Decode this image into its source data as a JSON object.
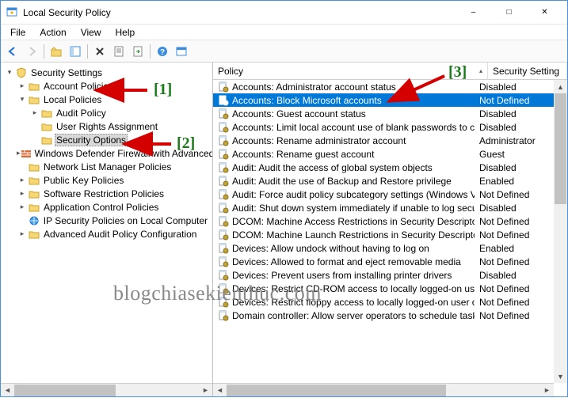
{
  "window": {
    "title": "Local Security Policy"
  },
  "menu": {
    "file": "File",
    "action": "Action",
    "view": "View",
    "help": "Help"
  },
  "tree": {
    "root": "Security Settings",
    "nodes": [
      {
        "label": "Account Policies",
        "level": 1,
        "exp": "closed",
        "icon": "folder"
      },
      {
        "label": "Local Policies",
        "level": 1,
        "exp": "open",
        "icon": "folder"
      },
      {
        "label": "Audit Policy",
        "level": 2,
        "exp": "closed",
        "icon": "folder"
      },
      {
        "label": "User Rights Assignment",
        "level": 2,
        "exp": "leaf",
        "icon": "folder"
      },
      {
        "label": "Security Options",
        "level": 2,
        "exp": "leaf",
        "icon": "folder",
        "selected": true
      },
      {
        "label": "Windows Defender Firewall with Advanced Security",
        "level": 1,
        "exp": "closed",
        "icon": "firewall"
      },
      {
        "label": "Network List Manager Policies",
        "level": 1,
        "exp": "leaf",
        "icon": "folder"
      },
      {
        "label": "Public Key Policies",
        "level": 1,
        "exp": "closed",
        "icon": "folder"
      },
      {
        "label": "Software Restriction Policies",
        "level": 1,
        "exp": "closed",
        "icon": "folder"
      },
      {
        "label": "Application Control Policies",
        "level": 1,
        "exp": "closed",
        "icon": "folder"
      },
      {
        "label": "IP Security Policies on Local Computer",
        "level": 1,
        "exp": "leaf",
        "icon": "ipsec"
      },
      {
        "label": "Advanced Audit Policy Configuration",
        "level": 1,
        "exp": "closed",
        "icon": "folder"
      }
    ]
  },
  "list": {
    "header_policy": "Policy",
    "header_setting": "Security Setting",
    "rows": [
      {
        "policy": "Accounts: Administrator account status",
        "setting": "Disabled",
        "selected": false
      },
      {
        "policy": "Accounts: Block Microsoft accounts",
        "setting": "Not Defined",
        "selected": true
      },
      {
        "policy": "Accounts: Guest account status",
        "setting": "Disabled",
        "selected": false
      },
      {
        "policy": "Accounts: Limit local account use of blank passwords to co...",
        "setting": "Disabled",
        "selected": false
      },
      {
        "policy": "Accounts: Rename administrator account",
        "setting": "Administrator",
        "selected": false
      },
      {
        "policy": "Accounts: Rename guest account",
        "setting": "Guest",
        "selected": false
      },
      {
        "policy": "Audit: Audit the access of global system objects",
        "setting": "Disabled",
        "selected": false
      },
      {
        "policy": "Audit: Audit the use of Backup and Restore privilege",
        "setting": "Enabled",
        "selected": false
      },
      {
        "policy": "Audit: Force audit policy subcategory settings (Windows Vis...",
        "setting": "Not Defined",
        "selected": false
      },
      {
        "policy": "Audit: Shut down system immediately if unable to log secur...",
        "setting": "Disabled",
        "selected": false
      },
      {
        "policy": "DCOM: Machine Access Restrictions in Security Descriptor D...",
        "setting": "Not Defined",
        "selected": false
      },
      {
        "policy": "DCOM: Machine Launch Restrictions in Security Descriptor ...",
        "setting": "Not Defined",
        "selected": false
      },
      {
        "policy": "Devices: Allow undock without having to log on",
        "setting": "Enabled",
        "selected": false
      },
      {
        "policy": "Devices: Allowed to format and eject removable media",
        "setting": "Not Defined",
        "selected": false
      },
      {
        "policy": "Devices: Prevent users from installing printer drivers",
        "setting": "Disabled",
        "selected": false
      },
      {
        "policy": "Devices: Restrict CD-ROM access to locally logged-on user ...",
        "setting": "Not Defined",
        "selected": false
      },
      {
        "policy": "Devices: Restrict floppy access to locally logged-on user only",
        "setting": "Not Defined",
        "selected": false
      },
      {
        "policy": "Domain controller: Allow server operators to schedule tasks",
        "setting": "Not Defined",
        "selected": false
      }
    ]
  },
  "annotations": {
    "l1": "[1]",
    "l2": "[2]",
    "l3": "[3]",
    "watermark": "blogchiasekienthuc.com"
  }
}
